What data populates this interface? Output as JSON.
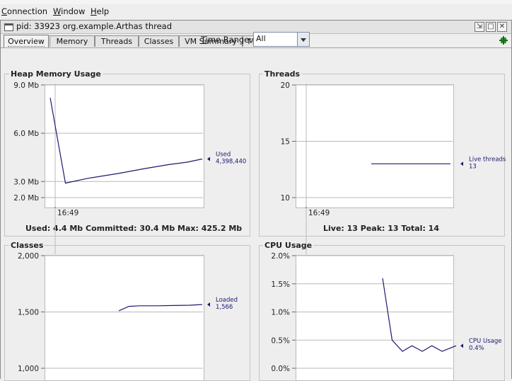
{
  "menubar": {
    "items": [
      {
        "mnemonic": "C",
        "rest": "onnection"
      },
      {
        "mnemonic": "W",
        "rest": "indow"
      },
      {
        "mnemonic": "H",
        "rest": "elp"
      }
    ]
  },
  "window": {
    "title": "pid: 33923 org.example.Arthas thread",
    "controls": [
      "restore-icon",
      "maximize-icon",
      "close-icon"
    ]
  },
  "tabs": [
    "Overview",
    "Memory",
    "Threads",
    "Classes",
    "VM Summary",
    "MBeans"
  ],
  "active_tab": "Overview",
  "time_range": {
    "mnemonic": "T",
    "rest": "ime Range:",
    "selected": "All"
  },
  "colors": {
    "series": "#1a1a70",
    "grid": "#b9b9b9",
    "axis": "#666666",
    "plot_bg": "#ffffff"
  },
  "panels": {
    "heap": {
      "title": "Heap Memory Usage",
      "y_ticks": [
        "9.0 Mb",
        "6.0 Mb",
        "3.0 Mb",
        "2.0 Mb"
      ],
      "x_tick": "16:49",
      "legend_name": "Used",
      "legend_value": "4,398,440",
      "stats": "Used: 4.4 Mb    Committed: 30.4 Mb    Max: 425.2 Mb"
    },
    "threads": {
      "title": "Threads",
      "y_ticks": [
        "20",
        "15",
        "10"
      ],
      "x_tick": "16:49",
      "legend_name": "Live threads",
      "legend_value": "13",
      "stats": "Live: 13    Peak: 13    Total: 14"
    },
    "classes": {
      "title": "Classes",
      "y_ticks": [
        "2,000",
        "1,500",
        "1,000"
      ],
      "legend_name": "Loaded",
      "legend_value": "1,566"
    },
    "cpu": {
      "title": "CPU Usage",
      "y_ticks": [
        "2.0%",
        "1.5%",
        "1.0%",
        "0.5%",
        "0.0%"
      ],
      "legend_name": "CPU Usage",
      "legend_value": "0.4%"
    }
  },
  "chart_data": [
    {
      "type": "line",
      "title": "Heap Memory Usage",
      "ylim": [
        2.0,
        9.0
      ],
      "y_unit": "Mb",
      "x": [
        0.0,
        0.1,
        0.25,
        0.45,
        0.62,
        0.78,
        0.9,
        1.0
      ],
      "series": [
        {
          "name": "Used",
          "values": [
            8.2,
            2.9,
            3.2,
            3.5,
            3.8,
            4.05,
            4.2,
            4.4
          ]
        }
      ]
    },
    {
      "type": "line",
      "title": "Threads",
      "ylim": [
        10,
        20
      ],
      "x": [
        0.0,
        1.0
      ],
      "series": [
        {
          "name": "Live threads",
          "values": [
            13,
            13
          ]
        }
      ]
    },
    {
      "type": "line",
      "title": "Classes",
      "ylim": [
        1000,
        2000
      ],
      "x": [
        0.0,
        0.12,
        0.25,
        0.45,
        0.65,
        0.85,
        1.0
      ],
      "series": [
        {
          "name": "Loaded",
          "values": [
            1510,
            1550,
            1555,
            1555,
            1557,
            1560,
            1566
          ]
        }
      ]
    },
    {
      "type": "line",
      "title": "CPU Usage",
      "ylim": [
        0.0,
        2.0
      ],
      "y_unit": "%",
      "x": [
        0.0,
        0.13,
        0.27,
        0.4,
        0.54,
        0.67,
        0.81,
        1.0
      ],
      "series": [
        {
          "name": "CPU Usage",
          "values": [
            1.6,
            0.5,
            0.3,
            0.4,
            0.3,
            0.4,
            0.3,
            0.4
          ]
        }
      ]
    }
  ]
}
